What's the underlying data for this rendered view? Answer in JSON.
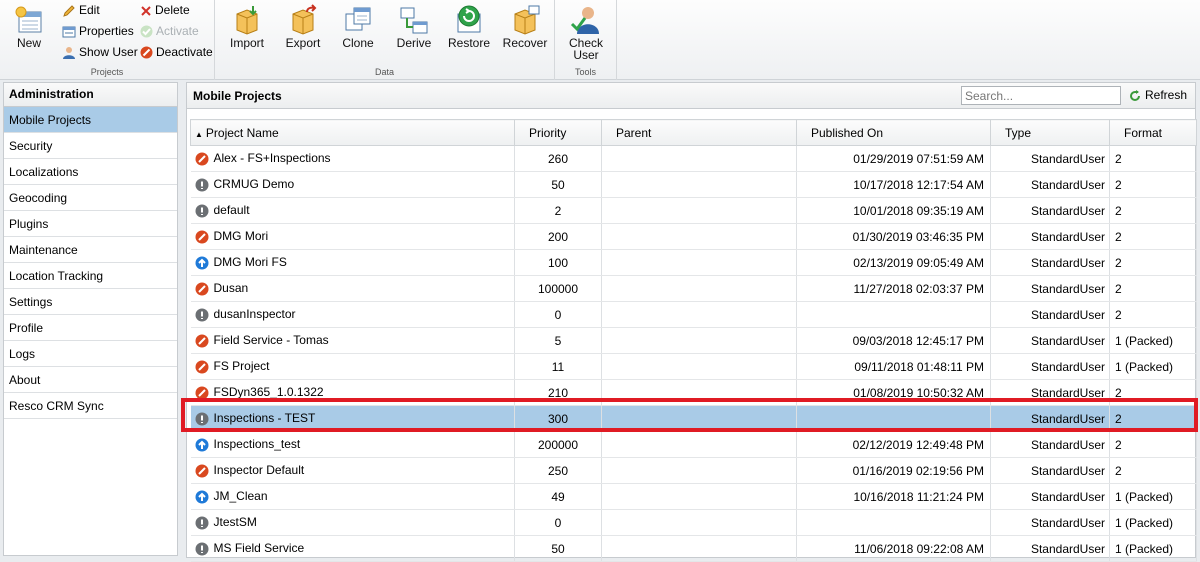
{
  "ribbon": {
    "projects_group": {
      "label": "Projects",
      "new": "New",
      "edit": "Edit",
      "delete": "Delete",
      "properties": "Properties",
      "activate": "Activate",
      "show_user": "Show User",
      "deactivate": "Deactivate"
    },
    "data_group": {
      "label": "Data",
      "import": "Import",
      "export": "Export",
      "clone": "Clone",
      "derive": "Derive",
      "restore": "Restore",
      "recover": "Recover"
    },
    "tools_group": {
      "label": "Tools",
      "check_user_line1": "Check",
      "check_user_line2": "User"
    }
  },
  "nav": {
    "header": "Administration",
    "items": [
      "Mobile Projects",
      "Security",
      "Localizations",
      "Geocoding",
      "Plugins",
      "Maintenance",
      "Location Tracking",
      "Settings",
      "Profile",
      "Logs",
      "About",
      "Resco CRM Sync"
    ],
    "active_index": 0
  },
  "main": {
    "title": "Mobile Projects",
    "search_placeholder": "Search...",
    "refresh": "Refresh"
  },
  "grid": {
    "columns": [
      "Project Name",
      "Priority",
      "Parent",
      "Published On",
      "Type",
      "Format"
    ],
    "sort_indicator": "▲",
    "selected_index": 11,
    "status_colors": {
      "deactivated": "#d9481f",
      "inactive": "#6b6f73",
      "active": "#1f7ad8"
    },
    "rows": [
      {
        "status": "deactivated",
        "name": "Alex - FS+Inspections",
        "priority": "260",
        "parent": "",
        "published": "01/29/2019 07:51:59 AM",
        "type": "StandardUser",
        "format": "2"
      },
      {
        "status": "inactive",
        "name": "CRMUG Demo",
        "priority": "50",
        "parent": "",
        "published": "10/17/2018 12:17:54 AM",
        "type": "StandardUser",
        "format": "2"
      },
      {
        "status": "inactive",
        "name": "default",
        "priority": "2",
        "parent": "",
        "published": "10/01/2018 09:35:19 AM",
        "type": "StandardUser",
        "format": "2"
      },
      {
        "status": "deactivated",
        "name": "DMG Mori",
        "priority": "200",
        "parent": "",
        "published": "01/30/2019 03:46:35 PM",
        "type": "StandardUser",
        "format": "2"
      },
      {
        "status": "active",
        "name": "DMG Mori FS",
        "priority": "100",
        "parent": "",
        "published": "02/13/2019 09:05:49 AM",
        "type": "StandardUser",
        "format": "2"
      },
      {
        "status": "deactivated",
        "name": "Dusan",
        "priority": "100000",
        "parent": "",
        "published": "11/27/2018 02:03:37 PM",
        "type": "StandardUser",
        "format": "2"
      },
      {
        "status": "inactive",
        "name": "dusanInspector",
        "priority": "0",
        "parent": "",
        "published": "",
        "type": "StandardUser",
        "format": "2"
      },
      {
        "status": "deactivated",
        "name": "Field Service - Tomas",
        "priority": "5",
        "parent": "",
        "published": "09/03/2018 12:45:17 PM",
        "type": "StandardUser",
        "format": "1 (Packed)"
      },
      {
        "status": "deactivated",
        "name": "FS Project",
        "priority": "11",
        "parent": "",
        "published": "09/11/2018 01:48:11 PM",
        "type": "StandardUser",
        "format": "1 (Packed)"
      },
      {
        "status": "deactivated",
        "name": "FSDyn365_1.0.1322",
        "priority": "210",
        "parent": "",
        "published": "01/08/2019 10:50:32 AM",
        "type": "StandardUser",
        "format": "2"
      },
      {
        "status": "inactive",
        "name": "Inspections - TEST",
        "priority": "300",
        "parent": "",
        "published": "",
        "type": "StandardUser",
        "format": "2"
      },
      {
        "status": "active",
        "name": "Inspections_test",
        "priority": "200000",
        "parent": "",
        "published": "02/12/2019 12:49:48 PM",
        "type": "StandardUser",
        "format": "2"
      },
      {
        "status": "deactivated",
        "name": "Inspector Default",
        "priority": "250",
        "parent": "",
        "published": "01/16/2019 02:19:56 PM",
        "type": "StandardUser",
        "format": "2"
      },
      {
        "status": "active",
        "name": "JM_Clean",
        "priority": "49",
        "parent": "",
        "published": "10/16/2018 11:21:24 PM",
        "type": "StandardUser",
        "format": "1 (Packed)"
      },
      {
        "status": "inactive",
        "name": "JtestSM",
        "priority": "0",
        "parent": "",
        "published": "",
        "type": "StandardUser",
        "format": "1 (Packed)"
      },
      {
        "status": "inactive",
        "name": "MS Field Service",
        "priority": "50",
        "parent": "",
        "published": "11/06/2018 09:22:08 AM",
        "type": "StandardUser",
        "format": "1 (Packed)"
      }
    ]
  }
}
